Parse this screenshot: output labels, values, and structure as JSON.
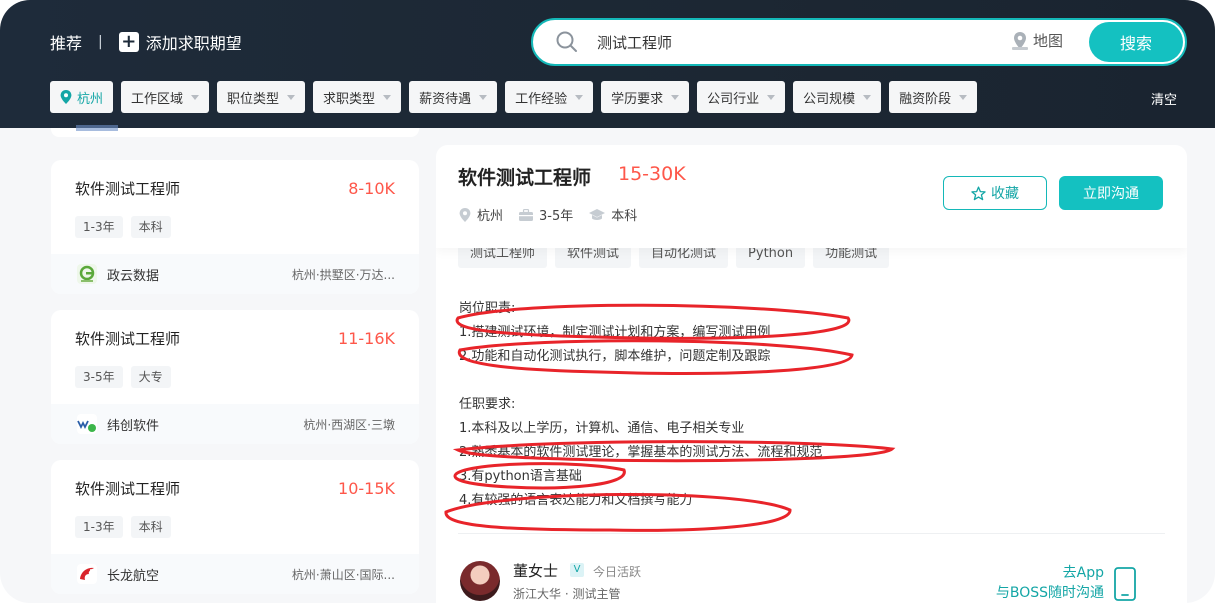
{
  "nav": {
    "recommend": "推荐",
    "separator": "|",
    "add_expectation": "添加求职期望"
  },
  "search": {
    "query": "测试工程师",
    "map_label": "地图",
    "button": "搜索"
  },
  "filters": {
    "city": "杭州",
    "items": [
      "工作区域",
      "职位类型",
      "求职类型",
      "薪资待遇",
      "工作经验",
      "学历要求",
      "公司行业",
      "公司规模",
      "融资阶段"
    ],
    "clear": "清空"
  },
  "jobs": [
    {
      "title": "软件测试工程师",
      "salary": "8-10K",
      "tags": [
        "1-3年",
        "本科"
      ],
      "company": "政云数据",
      "location": "杭州·拱墅区·万达..."
    },
    {
      "title": "软件测试工程师",
      "salary": "11-16K",
      "tags": [
        "3-5年",
        "大专"
      ],
      "company": "纬创软件",
      "location": "杭州·西湖区·三墩"
    },
    {
      "title": "软件测试工程师",
      "salary": "10-15K",
      "tags": [
        "1-3年",
        "本科"
      ],
      "company": "长龙航空",
      "location": "杭州·萧山区·国际..."
    }
  ],
  "detail": {
    "title": "软件测试工程师",
    "salary": "15-30K",
    "city": "杭州",
    "experience": "3-5年",
    "education": "本科",
    "fav_button": "收藏",
    "chat_button": "立即沟通",
    "skills": [
      "测试工程师",
      "软件测试",
      "自动化测试",
      "Python",
      "功能测试"
    ],
    "duties_title": "岗位职责:",
    "duties": [
      "1.搭建测试环境，制定测试计划和方案，编写测试用例",
      "2.功能和自动化测试执行，脚本维护，问题定制及跟踪"
    ],
    "req_title": "任职要求:",
    "requirements": [
      "1.本科及以上学历，计算机、通信、电子相关专业",
      "2.熟悉基本的软件测试理论，掌握基本的测试方法、流程和规范",
      "3.有python语言基础",
      "4.有较强的语言表达能力和文档撰写能力"
    ]
  },
  "recruiter": {
    "name": "董女士",
    "status": "今日活跃",
    "org": "浙江大华 · 测试主管",
    "app_line1": "去App",
    "app_line2": "与BOSS随时沟通"
  },
  "colors": {
    "accent": "#14c1c1",
    "salary": "#fe574a",
    "header": "#1e2b3a",
    "annotation": "#e8242a"
  }
}
